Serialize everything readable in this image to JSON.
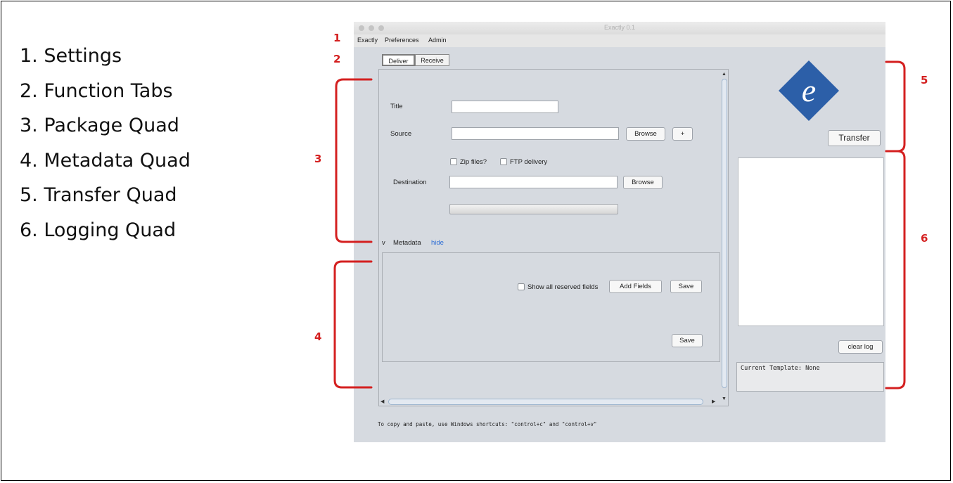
{
  "legend": [
    "1.  Settings",
    "2.  Function Tabs",
    "3.  Package Quad",
    "4.  Metadata Quad",
    "5.  Transfer Quad",
    "6.  Logging Quad"
  ],
  "window": {
    "title": "Exactly 0.1"
  },
  "menu": [
    "Exactly",
    "Preferences",
    "Admin"
  ],
  "tabs": {
    "deliver": "Deliver",
    "receive": "Receive",
    "selected": "Deliver"
  },
  "package": {
    "title_label": "Title",
    "title_value": "",
    "source_label": "Source",
    "source_value": "",
    "browse_label": "Browse",
    "add_label": "+",
    "zip_label": "Zip files?",
    "zip_checked": false,
    "ftp_label": "FTP delivery",
    "ftp_checked": false,
    "destination_label": "Destination",
    "destination_value": "",
    "progress": 0
  },
  "metadata": {
    "toggle": "v",
    "label": "Metadata",
    "hide_link": "hide",
    "show_reserved_label": "Show all reserved fields",
    "show_reserved_checked": false,
    "add_fields_label": "Add Fields",
    "save_label": "Save"
  },
  "transfer": {
    "button_label": "Transfer",
    "logo_letter": "e"
  },
  "logging": {
    "clear_label": "clear log",
    "template_text": "Current Template: None"
  },
  "footer": "To copy and paste, use Windows shortcuts: \"control+c\" and \"control+v\"",
  "annotations": [
    "1",
    "2",
    "3",
    "4",
    "5",
    "6"
  ],
  "colors": {
    "annotation": "#d42020",
    "logo": "#2c5fa8",
    "link": "#2f6fd6",
    "window_bg": "#d6dae0"
  }
}
